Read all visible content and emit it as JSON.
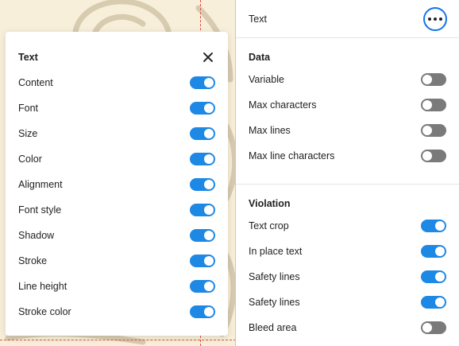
{
  "popup": {
    "title": "Text",
    "items": [
      {
        "label": "Content",
        "on": true
      },
      {
        "label": "Font",
        "on": true
      },
      {
        "label": "Size",
        "on": true
      },
      {
        "label": "Color",
        "on": true
      },
      {
        "label": "Alignment",
        "on": true
      },
      {
        "label": "Font style",
        "on": true
      },
      {
        "label": "Shadow",
        "on": true
      },
      {
        "label": "Stroke",
        "on": true
      },
      {
        "label": "Line height",
        "on": true
      },
      {
        "label": "Stroke color",
        "on": true
      }
    ]
  },
  "panel": {
    "header_label": "Text",
    "data": {
      "title": "Data",
      "items": [
        {
          "label": "Variable",
          "on": false
        },
        {
          "label": "Max characters",
          "on": false
        },
        {
          "label": "Max lines",
          "on": false
        },
        {
          "label": "Max line characters",
          "on": false
        }
      ]
    },
    "violation": {
      "title": "Violation",
      "items": [
        {
          "label": "Text crop",
          "on": true
        },
        {
          "label": "In place text",
          "on": true
        },
        {
          "label": "Safety lines",
          "on": true
        },
        {
          "label": "Safety lines",
          "on": true
        },
        {
          "label": "Bleed area",
          "on": false
        }
      ]
    }
  },
  "colors": {
    "toggle_on": "#1e88e5",
    "toggle_off": "#7a7a7a",
    "accent_ring": "#1473e6",
    "canvas_bg": "#f7efd9",
    "guide": "#e0524a"
  }
}
